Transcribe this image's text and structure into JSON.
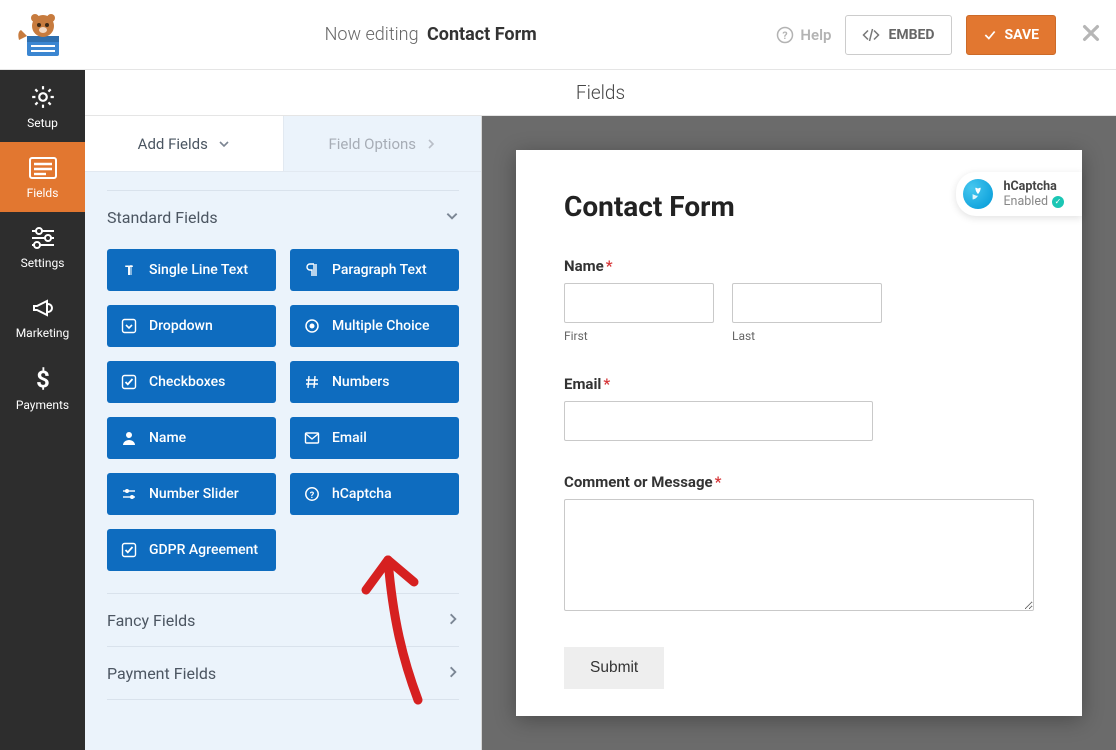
{
  "topbar": {
    "editing_label": "Now editing",
    "form_name": "Contact Form",
    "help_label": "Help",
    "embed_label": "EMBED",
    "save_label": "SAVE"
  },
  "nav": {
    "setup": "Setup",
    "fields": "Fields",
    "settings": "Settings",
    "marketing": "Marketing",
    "payments": "Payments"
  },
  "subheader": {
    "title": "Fields"
  },
  "panel": {
    "tab_add": "Add Fields",
    "tab_options": "Field Options",
    "groups": {
      "standard": "Standard Fields",
      "fancy": "Fancy Fields",
      "payment": "Payment Fields"
    },
    "fields": {
      "single_line": "Single Line Text",
      "paragraph": "Paragraph Text",
      "dropdown": "Dropdown",
      "multiple": "Multiple Choice",
      "checkboxes": "Checkboxes",
      "numbers": "Numbers",
      "name": "Name",
      "email": "Email",
      "slider": "Number Slider",
      "hcaptcha": "hCaptcha",
      "gdpr": "GDPR Agreement"
    }
  },
  "preview": {
    "form_title": "Contact Form",
    "badge_title": "hCaptcha",
    "badge_status": "Enabled",
    "label_name": "Name",
    "sublabel_first": "First",
    "sublabel_last": "Last",
    "label_email": "Email",
    "label_comment": "Comment or Message",
    "submit": "Submit"
  }
}
